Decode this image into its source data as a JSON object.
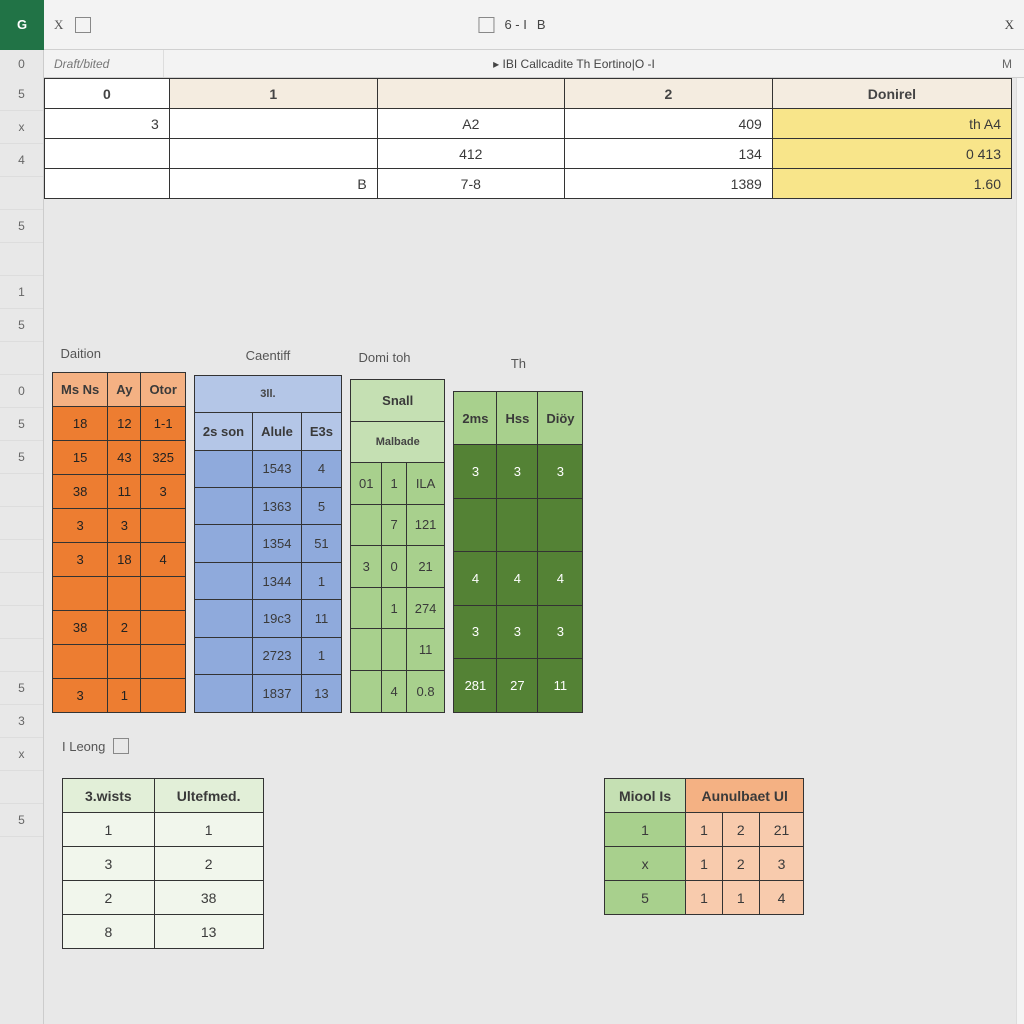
{
  "titlebar": {
    "corner": "G",
    "left_x": "X",
    "center_frag1": "6 - I",
    "center_frag2": "B",
    "right_close": "X",
    "right_small": "M"
  },
  "formula_bar": {
    "corner": "0",
    "name_box": "Draft/bited",
    "center": "▸ IBI Callcadite Th Eortino|O -I"
  },
  "column_headers": {
    "c0": "0",
    "c1": "1",
    "c2": "2",
    "c3": "Donirel"
  },
  "top_rows": [
    {
      "a": "3",
      "b": "",
      "c": "A2",
      "d": "409",
      "e": "th A4"
    },
    {
      "a": "",
      "b": "",
      "c": "412",
      "d": "134",
      "e": "0 413"
    },
    {
      "a": "",
      "b": "B",
      "c": "7-8",
      "d": "1389",
      "e": "1.60"
    }
  ],
  "row_headers": [
    "5",
    "x",
    "4",
    "",
    "5",
    "",
    "1",
    "5",
    "",
    "0",
    "5",
    "5",
    "",
    "",
    "",
    "",
    "",
    "",
    "5",
    "3",
    "x",
    "",
    "5"
  ],
  "orange_table": {
    "title": "Daition",
    "headers": [
      "Ms Ns",
      "Ay",
      "Otor"
    ],
    "rows": [
      [
        "18",
        "12",
        "1-1"
      ],
      [
        "15",
        "43",
        "325"
      ],
      [
        "38",
        "11",
        "3"
      ],
      [
        "3",
        "3",
        ""
      ],
      [
        "3",
        "18",
        "4"
      ],
      [
        "",
        "",
        ""
      ],
      [
        "38",
        "2",
        ""
      ],
      [
        "",
        "",
        ""
      ],
      [
        "3",
        "1",
        ""
      ]
    ]
  },
  "blue_table": {
    "title": "Caentiff",
    "sub": "3ll.",
    "headers": [
      "2s son",
      "Alule",
      "E3s"
    ],
    "rows": [
      [
        "",
        "1543",
        "4"
      ],
      [
        "",
        "1363",
        "5"
      ],
      [
        "",
        "1354",
        "51"
      ],
      [
        "",
        "1344",
        "1"
      ],
      [
        "",
        "19c3",
        "11"
      ],
      [
        "",
        "2723",
        "1"
      ],
      [
        "",
        "1837",
        "13"
      ]
    ]
  },
  "lgreen_table": {
    "title": "Domi toh",
    "sub1": "Snall",
    "sub2": "Malbade",
    "rows": [
      [
        "01",
        "1",
        "ILA"
      ],
      [
        "",
        "7",
        "121"
      ],
      [
        "3",
        "0",
        "21"
      ],
      [
        "",
        "1",
        "274"
      ],
      [
        "",
        "",
        "11"
      ],
      [
        "",
        "4",
        "0.8"
      ]
    ]
  },
  "dgreen_table": {
    "title": "Th",
    "headers": [
      "2ms",
      "Hss",
      "Diöy"
    ],
    "rows": [
      [
        "3",
        "3",
        "3"
      ],
      [
        "",
        "",
        ""
      ],
      [
        "4",
        "4",
        "4"
      ],
      [
        "3",
        "3",
        "3"
      ],
      [
        "281",
        "27",
        "11"
      ]
    ]
  },
  "long_label": "I Leong",
  "bottom_left": {
    "headers": [
      "3.wists",
      "Ultefmed."
    ],
    "rows": [
      [
        "1",
        "1"
      ],
      [
        "3",
        "2"
      ],
      [
        "2",
        "38"
      ],
      [
        "8",
        "13"
      ]
    ]
  },
  "bottom_right": {
    "header_g": "Miool Is",
    "header_o": "Aunulbaet  Ul",
    "rows": [
      {
        "g": "1",
        "o": [
          "1",
          "2",
          "21"
        ]
      },
      {
        "g": "x",
        "o": [
          "1",
          "2",
          "3"
        ]
      },
      {
        "g": "5",
        "o": [
          "1",
          "1",
          "4"
        ]
      }
    ]
  }
}
